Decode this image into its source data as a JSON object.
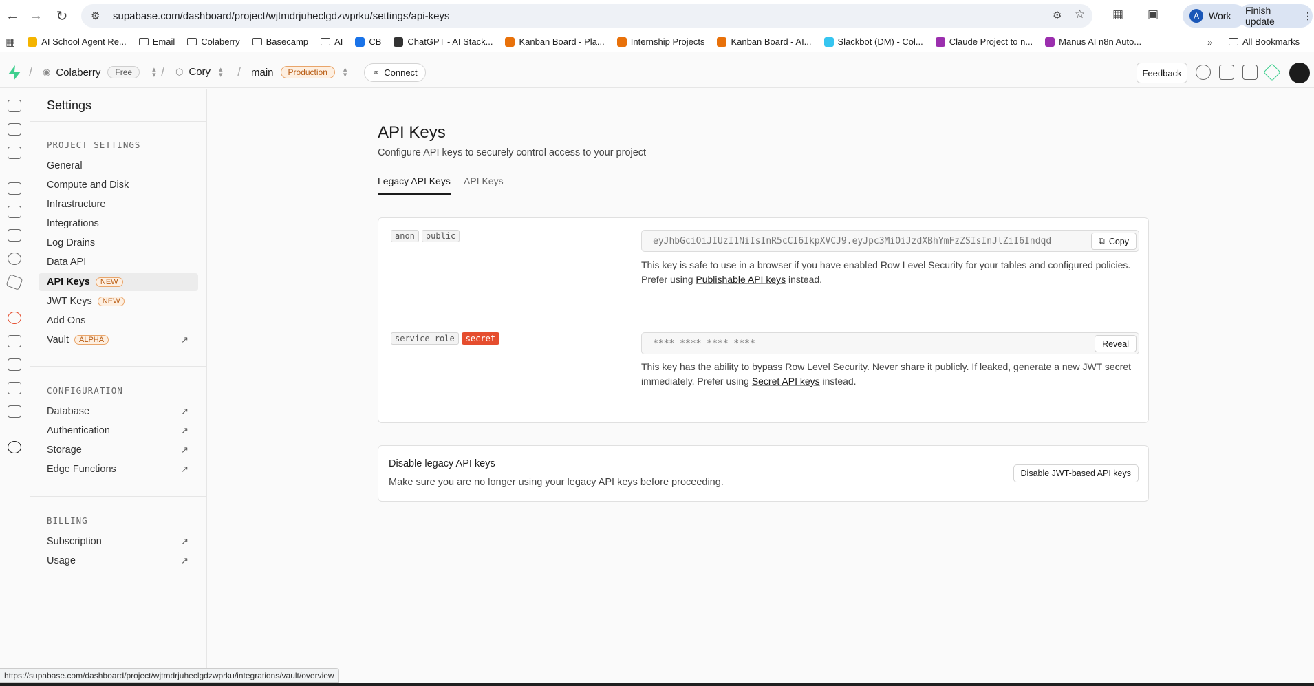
{
  "browser": {
    "url": "supabase.com/dashboard/project/wjtmdrjuheclgdzwprku/settings/api-keys",
    "profile_initial": "A",
    "profile_label": "Work",
    "finish_update_label": "Finish update",
    "bookmarks": [
      {
        "label": "AI School Agent Re...",
        "color": "#f4b400",
        "folder": false
      },
      {
        "label": "Email",
        "folder": true
      },
      {
        "label": "Colaberry",
        "folder": true
      },
      {
        "label": "Basecamp",
        "folder": true
      },
      {
        "label": "AI",
        "folder": true
      },
      {
        "label": "CB",
        "color": "#1a73e8",
        "folder": false
      },
      {
        "label": "ChatGPT - AI Stack...",
        "color": "#333333",
        "folder": false
      },
      {
        "label": "Kanban Board - Pla...",
        "color": "#e8710a",
        "folder": false
      },
      {
        "label": "Internship Projects",
        "color": "#e8710a",
        "folder": false
      },
      {
        "label": "Kanban Board - AI...",
        "color": "#e8710a",
        "folder": false
      },
      {
        "label": "Slackbot (DM) - Col...",
        "color": "#36c5f0",
        "folder": false
      },
      {
        "label": "Claude Project to n...",
        "color": "#9b2fae",
        "folder": false
      },
      {
        "label": "Manus AI n8n Auto...",
        "color": "#9b2fae",
        "folder": false
      }
    ],
    "all_bookmarks_label": "All Bookmarks",
    "status_url": "https://supabase.com/dashboard/project/wjtmdrjuheclgdzwprku/integrations/vault/overview"
  },
  "header": {
    "org_name": "Colaberry",
    "org_plan": "Free",
    "project_name": "Cory",
    "branch_name": "main",
    "branch_env": "Production",
    "connect_label": "Connect",
    "feedback_label": "Feedback"
  },
  "sidebar": {
    "title": "Settings",
    "project_settings_header": "PROJECT SETTINGS",
    "project_items": [
      {
        "label": "General"
      },
      {
        "label": "Compute and Disk"
      },
      {
        "label": "Infrastructure"
      },
      {
        "label": "Integrations"
      },
      {
        "label": "Log Drains"
      },
      {
        "label": "Data API"
      },
      {
        "label": "API Keys",
        "tag": "NEW"
      },
      {
        "label": "JWT Keys",
        "tag": "NEW"
      },
      {
        "label": "Add Ons"
      },
      {
        "label": "Vault",
        "tag": "ALPHA"
      }
    ],
    "configuration_header": "CONFIGURATION",
    "configuration_items": [
      {
        "label": "Database"
      },
      {
        "label": "Authentication"
      },
      {
        "label": "Storage"
      },
      {
        "label": "Edge Functions"
      }
    ],
    "billing_header": "BILLING",
    "billing_items": [
      {
        "label": "Subscription"
      },
      {
        "label": "Usage"
      }
    ]
  },
  "main": {
    "title": "API Keys",
    "subtitle": "Configure API keys to securely control access to your project",
    "tabs": [
      {
        "label": "Legacy API Keys",
        "active": true
      },
      {
        "label": "API Keys",
        "active": false
      }
    ],
    "anon": {
      "tag1": "anon",
      "tag2": "public",
      "value": "eyJhbGciOiJIUzI1NiIsInR5cCI6IkpXVCJ9.eyJpc3MiOiJzdXBhYmFzZSIsInJlZiI6Indqd",
      "copy_label": "Copy",
      "desc_line1": "This key is safe to use in a browser if you have enabled Row Level Security for your tables and configured policies.",
      "desc_prefix": "Prefer using ",
      "desc_link": "Publishable API keys",
      "desc_suffix": " instead."
    },
    "service": {
      "tag1": "service_role",
      "tag2": "secret",
      "value": "**** **** **** ****",
      "reveal_label": "Reveal",
      "desc_line1": "This key has the ability to bypass Row Level Security. Never share it publicly. If leaked, generate a new JWT secret",
      "desc_prefix": "immediately. Prefer using ",
      "desc_link": "Secret API keys",
      "desc_suffix": " instead."
    },
    "disable": {
      "title": "Disable legacy API keys",
      "desc": "Make sure you are no longer using your legacy API keys before proceeding.",
      "button": "Disable JWT-based API keys"
    }
  }
}
